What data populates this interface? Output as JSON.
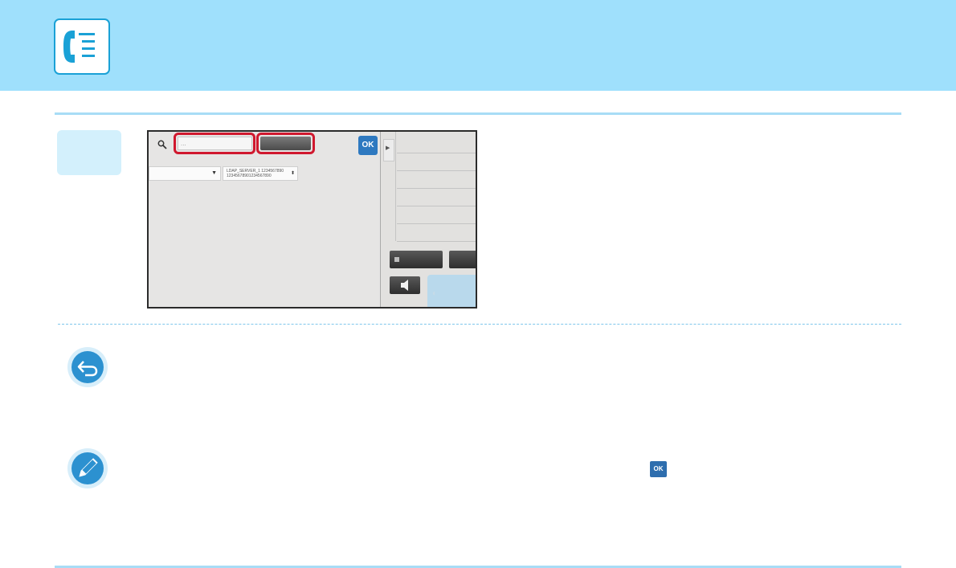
{
  "header": {
    "icon": "fax-address-book-icon",
    "accent_color": "#9fe0fc"
  },
  "screen": {
    "keyword_placeholder": "...",
    "ok_label": "OK",
    "server_name": "LDAP_SERVER_1 1234567890\n12345678901234567890",
    "highlight_color": "#d0182e"
  },
  "notes": {
    "return_icon": "return-icon",
    "note_icon": "pencil-icon",
    "inline_ok_label": "OK"
  }
}
